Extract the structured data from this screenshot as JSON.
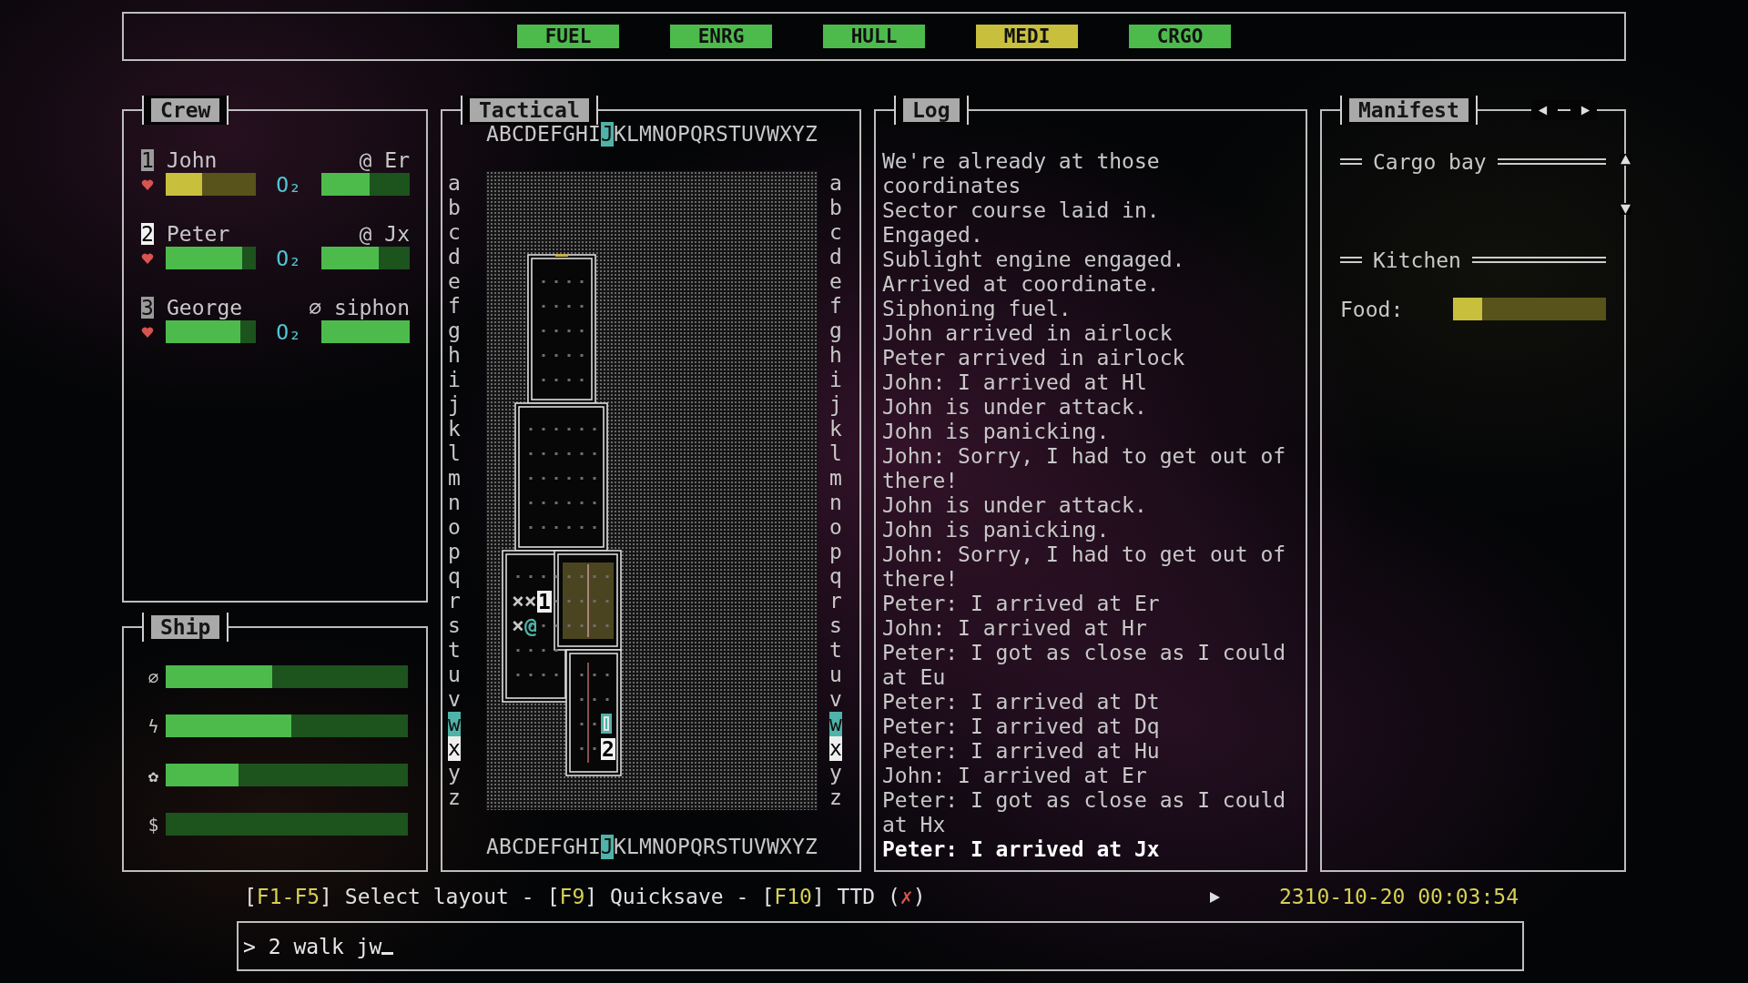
{
  "top_bar": {
    "systems": [
      {
        "label": "FUEL",
        "warning": false
      },
      {
        "label": "ENRG",
        "warning": false
      },
      {
        "label": "HULL",
        "warning": false
      },
      {
        "label": "MEDI",
        "warning": true
      },
      {
        "label": "CRGO",
        "warning": false
      }
    ]
  },
  "crew_panel": {
    "title": "Crew",
    "crew": [
      {
        "index": "1",
        "name": "John",
        "location": "@ Er",
        "selected": false,
        "health": {
          "level": 0.4,
          "warning": true
        },
        "o2_label": "O₂",
        "o2": {
          "level": 0.55,
          "warning": false
        }
      },
      {
        "index": "2",
        "name": "Peter",
        "location": "@ Jx",
        "selected": true,
        "health": {
          "level": 0.85,
          "warning": false
        },
        "o2_label": "O₂",
        "o2": {
          "level": 0.65,
          "warning": false
        }
      },
      {
        "index": "3",
        "name": "George",
        "location": "⌀ siphon",
        "selected": false,
        "health": {
          "level": 0.83,
          "warning": false
        },
        "o2_label": "O₂",
        "o2": {
          "level": 1.0,
          "warning": false
        }
      }
    ]
  },
  "ship_panel": {
    "title": "Ship",
    "gauges": [
      {
        "symbol": "⌀",
        "level": 0.44
      },
      {
        "symbol": "ϟ",
        "level": 0.52
      },
      {
        "symbol": "✿",
        "level": 0.3
      },
      {
        "symbol": "$",
        "level": 0
      }
    ]
  },
  "tactical": {
    "title": "Tactical",
    "columns_top": [
      {
        "label": "A",
        "cursor": false,
        "marked": false
      },
      {
        "label": "B",
        "cursor": false,
        "marked": false
      },
      {
        "label": "C",
        "cursor": false,
        "marked": false
      },
      {
        "label": "D",
        "cursor": false,
        "marked": false
      },
      {
        "label": "E",
        "cursor": false,
        "marked": false
      },
      {
        "label": "F",
        "cursor": false,
        "marked": false
      },
      {
        "label": "G",
        "cursor": false,
        "marked": false
      },
      {
        "label": "H",
        "cursor": false,
        "marked": false
      },
      {
        "label": "I",
        "cursor": false,
        "marked": false
      },
      {
        "label": "J",
        "cursor": true,
        "marked": false
      },
      {
        "label": "K",
        "cursor": false,
        "marked": false
      },
      {
        "label": "L",
        "cursor": false,
        "marked": false
      },
      {
        "label": "M",
        "cursor": false,
        "marked": false
      },
      {
        "label": "N",
        "cursor": false,
        "marked": false
      },
      {
        "label": "O",
        "cursor": false,
        "marked": false
      },
      {
        "label": "P",
        "cursor": false,
        "marked": false
      },
      {
        "label": "Q",
        "cursor": false,
        "marked": false
      },
      {
        "label": "R",
        "cursor": false,
        "marked": false
      },
      {
        "label": "S",
        "cursor": false,
        "marked": false
      },
      {
        "label": "T",
        "cursor": false,
        "marked": false
      },
      {
        "label": "U",
        "cursor": false,
        "marked": false
      },
      {
        "label": "V",
        "cursor": false,
        "marked": false
      },
      {
        "label": "W",
        "cursor": false,
        "marked": false
      },
      {
        "label": "X",
        "cursor": false,
        "marked": false
      },
      {
        "label": "Y",
        "cursor": false,
        "marked": false
      },
      {
        "label": "Z",
        "cursor": false,
        "marked": false
      }
    ],
    "rows_left": [
      {
        "label": "a",
        "cursor": false,
        "marked": false
      },
      {
        "label": "b",
        "cursor": false,
        "marked": false
      },
      {
        "label": "c",
        "cursor": false,
        "marked": false
      },
      {
        "label": "d",
        "cursor": false,
        "marked": false
      },
      {
        "label": "e",
        "cursor": false,
        "marked": false
      },
      {
        "label": "f",
        "cursor": false,
        "marked": false
      },
      {
        "label": "g",
        "cursor": false,
        "marked": false
      },
      {
        "label": "h",
        "cursor": false,
        "marked": false
      },
      {
        "label": "i",
        "cursor": false,
        "marked": false
      },
      {
        "label": "j",
        "cursor": false,
        "marked": false
      },
      {
        "label": "k",
        "cursor": false,
        "marked": false
      },
      {
        "label": "l",
        "cursor": false,
        "marked": false
      },
      {
        "label": "m",
        "cursor": false,
        "marked": false
      },
      {
        "label": "n",
        "cursor": false,
        "marked": false
      },
      {
        "label": "o",
        "cursor": false,
        "marked": false
      },
      {
        "label": "p",
        "cursor": false,
        "marked": false
      },
      {
        "label": "q",
        "cursor": false,
        "marked": false
      },
      {
        "label": "r",
        "cursor": false,
        "marked": false
      },
      {
        "label": "s",
        "cursor": false,
        "marked": false
      },
      {
        "label": "t",
        "cursor": false,
        "marked": false
      },
      {
        "label": "u",
        "cursor": false,
        "marked": false
      },
      {
        "label": "v",
        "cursor": false,
        "marked": false
      },
      {
        "label": "w",
        "cursor": true,
        "marked": false
      },
      {
        "label": "x",
        "cursor": false,
        "marked": true
      },
      {
        "label": "y",
        "cursor": false,
        "marked": false
      },
      {
        "label": "z",
        "cursor": false,
        "marked": false
      }
    ],
    "rows_right": [
      {
        "label": "a",
        "cursor": false,
        "marked": false
      },
      {
        "label": "b",
        "cursor": false,
        "marked": false
      },
      {
        "label": "c",
        "cursor": false,
        "marked": false
      },
      {
        "label": "d",
        "cursor": false,
        "marked": false
      },
      {
        "label": "e",
        "cursor": false,
        "marked": false
      },
      {
        "label": "f",
        "cursor": false,
        "marked": false
      },
      {
        "label": "g",
        "cursor": false,
        "marked": false
      },
      {
        "label": "h",
        "cursor": false,
        "marked": false
      },
      {
        "label": "i",
        "cursor": false,
        "marked": false
      },
      {
        "label": "j",
        "cursor": false,
        "marked": false
      },
      {
        "label": "k",
        "cursor": false,
        "marked": false
      },
      {
        "label": "l",
        "cursor": false,
        "marked": false
      },
      {
        "label": "m",
        "cursor": false,
        "marked": false
      },
      {
        "label": "n",
        "cursor": false,
        "marked": false
      },
      {
        "label": "o",
        "cursor": false,
        "marked": false
      },
      {
        "label": "p",
        "cursor": false,
        "marked": false
      },
      {
        "label": "q",
        "cursor": false,
        "marked": false
      },
      {
        "label": "r",
        "cursor": false,
        "marked": false
      },
      {
        "label": "s",
        "cursor": false,
        "marked": false
      },
      {
        "label": "t",
        "cursor": false,
        "marked": false
      },
      {
        "label": "u",
        "cursor": false,
        "marked": false
      },
      {
        "label": "v",
        "cursor": false,
        "marked": false
      },
      {
        "label": "w",
        "cursor": true,
        "marked": false
      },
      {
        "label": "x",
        "cursor": false,
        "marked": true
      },
      {
        "label": "y",
        "cursor": false,
        "marked": false
      },
      {
        "label": "z",
        "cursor": false,
        "marked": false
      }
    ],
    "columns_bottom": [
      {
        "label": "A",
        "cursor": false,
        "marked": false
      },
      {
        "label": "B",
        "cursor": false,
        "marked": false
      },
      {
        "label": "C",
        "cursor": false,
        "marked": false
      },
      {
        "label": "D",
        "cursor": false,
        "marked": false
      },
      {
        "label": "E",
        "cursor": false,
        "marked": false
      },
      {
        "label": "F",
        "cursor": false,
        "marked": false
      },
      {
        "label": "G",
        "cursor": false,
        "marked": false
      },
      {
        "label": "H",
        "cursor": false,
        "marked": false
      },
      {
        "label": "I",
        "cursor": false,
        "marked": false
      },
      {
        "label": "J",
        "cursor": true,
        "marked": false
      },
      {
        "label": "K",
        "cursor": false,
        "marked": false
      },
      {
        "label": "L",
        "cursor": false,
        "marked": false
      },
      {
        "label": "M",
        "cursor": false,
        "marked": false
      },
      {
        "label": "N",
        "cursor": false,
        "marked": false
      },
      {
        "label": "O",
        "cursor": false,
        "marked": false
      },
      {
        "label": "P",
        "cursor": false,
        "marked": false
      },
      {
        "label": "Q",
        "cursor": false,
        "marked": false
      },
      {
        "label": "R",
        "cursor": false,
        "marked": false
      },
      {
        "label": "S",
        "cursor": false,
        "marked": false
      },
      {
        "label": "T",
        "cursor": false,
        "marked": false
      },
      {
        "label": "U",
        "cursor": false,
        "marked": false
      },
      {
        "label": "V",
        "cursor": false,
        "marked": false
      },
      {
        "label": "W",
        "cursor": false,
        "marked": false
      },
      {
        "label": "X",
        "cursor": false,
        "marked": false
      },
      {
        "label": "Y",
        "cursor": false,
        "marked": false
      },
      {
        "label": "Z",
        "cursor": false,
        "marked": false
      }
    ],
    "markers": [
      {
        "kind": "hazard",
        "text": "××"
      },
      {
        "kind": "crew",
        "text": "1"
      },
      {
        "kind": "hazard",
        "text": "×"
      },
      {
        "kind": "actor",
        "text": "@"
      },
      {
        "kind": "cursor"
      },
      {
        "kind": "crew",
        "text": "2"
      }
    ]
  },
  "log": {
    "title": "Log",
    "lines": [
      {
        "text": "We're already at those coordinates",
        "latest": false
      },
      {
        "text": "Sector course laid in.",
        "latest": false
      },
      {
        "text": "Engaged.",
        "latest": false
      },
      {
        "text": "Sublight engine engaged.",
        "latest": false
      },
      {
        "text": "Arrived at coordinate.",
        "latest": false
      },
      {
        "text": "Siphoning fuel.",
        "latest": false
      },
      {
        "text": "John arrived in airlock",
        "latest": false
      },
      {
        "text": "Peter arrived in airlock",
        "latest": false
      },
      {
        "text": "John: I arrived at Hl",
        "latest": false
      },
      {
        "text": "John is under attack.",
        "latest": false
      },
      {
        "text": "John is panicking.",
        "latest": false
      },
      {
        "text": "John: Sorry, I had to get out of there!",
        "latest": false
      },
      {
        "text": "John is under attack.",
        "latest": false
      },
      {
        "text": "John is panicking.",
        "latest": false
      },
      {
        "text": "John: Sorry, I had to get out of there!",
        "latest": false
      },
      {
        "text": "Peter: I arrived at Er",
        "latest": false
      },
      {
        "text": "John: I arrived at Hr",
        "latest": false
      },
      {
        "text": "Peter: I got as close as I could at Eu",
        "latest": false
      },
      {
        "text": "Peter: I arrived at Dt",
        "latest": false
      },
      {
        "text": "Peter: I arrived at Dq",
        "latest": false
      },
      {
        "text": "Peter: I arrived at Hu",
        "latest": false
      },
      {
        "text": "John: I arrived at Er",
        "latest": false
      },
      {
        "text": "Peter: I got as close as I could at Hx",
        "latest": false
      },
      {
        "text": "Peter: I arrived at Jx",
        "latest": true
      }
    ]
  },
  "manifest": {
    "title": "Manifest",
    "sections": [
      {
        "title": "Cargo bay"
      },
      {
        "title": "Kitchen",
        "items": [
          {
            "label": "Food:",
            "level": 0.19,
            "warning": true
          }
        ]
      }
    ]
  },
  "status_bar": {
    "key_brackets": [
      "[",
      "]"
    ],
    "separator": "-",
    "mark_brackets": [
      "(",
      ")"
    ],
    "hints": [
      {
        "key": "F1-F5",
        "label": "Select layout"
      },
      {
        "key": "F9",
        "label": "Quicksave"
      },
      {
        "key": "F10",
        "label": "TTD",
        "mark": "✗",
        "on": false
      }
    ],
    "datetime": "2310-10-20 00:03:54"
  },
  "command": {
    "prompt": ">",
    "value": "2 walk jw"
  }
}
